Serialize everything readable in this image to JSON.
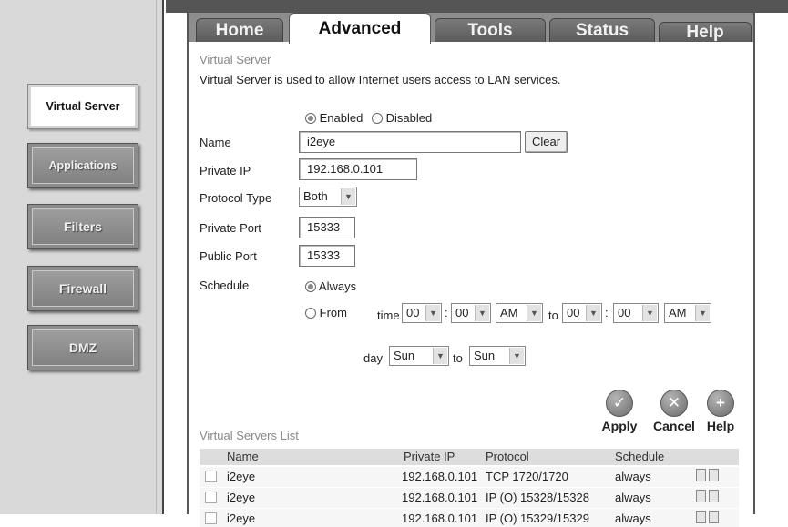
{
  "sidebar": {
    "items": [
      {
        "label": "Virtual Server",
        "active": true
      },
      {
        "label": "Applications",
        "active": false
      },
      {
        "label": "Filters",
        "active": false
      },
      {
        "label": "Firewall",
        "active": false
      },
      {
        "label": "DMZ",
        "active": false
      }
    ]
  },
  "tabs": [
    {
      "label": "Home"
    },
    {
      "label": "Advanced",
      "active": true
    },
    {
      "label": "Tools"
    },
    {
      "label": "Status"
    },
    {
      "label": "Help"
    }
  ],
  "section": {
    "title": "Virtual Server",
    "description": "Virtual Server is used to allow Internet users access to LAN services."
  },
  "form": {
    "enabled_label": "Enabled",
    "disabled_label": "Disabled",
    "name_label": "Name",
    "name_value": "i2eye",
    "clear_label": "Clear",
    "private_ip_label": "Private IP",
    "private_ip_value": "192.168.0.101",
    "protocol_label": "Protocol Type",
    "protocol_value": "Both",
    "private_port_label": "Private Port",
    "private_port_value": "15333",
    "public_port_label": "Public Port",
    "public_port_value": "15333",
    "schedule_label": "Schedule",
    "always_label": "Always",
    "from_label": "From",
    "time_label": "time",
    "to_label": "to",
    "day_label": "day",
    "colon": ":",
    "start_hour": "00",
    "start_min": "00",
    "start_ampm": "AM",
    "end_hour": "00",
    "end_min": "00",
    "end_ampm": "AM",
    "day_from": "Sun",
    "day_to": "Sun"
  },
  "actions": {
    "apply_label": "Apply",
    "cancel_label": "Cancel",
    "help_label": "Help"
  },
  "list": {
    "title": "Virtual Servers List",
    "headers": {
      "name": "Name",
      "private_ip": "Private IP",
      "protocol": "Protocol",
      "schedule": "Schedule"
    },
    "rows": [
      {
        "name": "i2eye",
        "private_ip": "192.168.0.101",
        "protocol": "TCP 1720/1720",
        "schedule": "always"
      },
      {
        "name": "i2eye",
        "private_ip": "192.168.0.101",
        "protocol": "IP (O) 15328/15328",
        "schedule": "always"
      },
      {
        "name": "i2eye",
        "private_ip": "192.168.0.101",
        "protocol": "IP (O) 15329/15329",
        "schedule": "always"
      }
    ]
  }
}
